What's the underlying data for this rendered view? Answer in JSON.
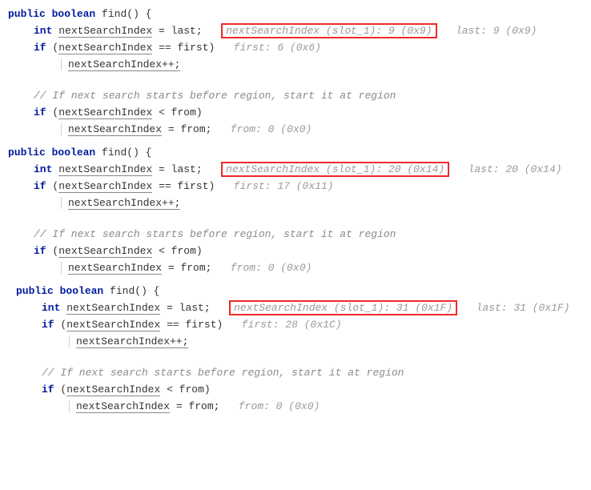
{
  "blocks": [
    {
      "sig_visibility": "public",
      "sig_type": "boolean",
      "sig_name": "find",
      "local_type": "int",
      "var_name": "nextSearchIndex",
      "assign_rhs": "last",
      "highlight_text": "nextSearchIndex (slot_1): 9 (0x9)",
      "last_annot": "last: 9 (0x9)",
      "cond1_rhs": "first",
      "first_annot": "first: 6 (0x6)",
      "incr_text": "nextSearchIndex++;",
      "comment_text": "// If next search starts before region, start it at region",
      "cond2_rhs": "from",
      "assign2_rhs": "from",
      "from_annot": "from: 0 (0x0)",
      "base_indent": 0
    },
    {
      "sig_visibility": "public",
      "sig_type": "boolean",
      "sig_name": "find",
      "local_type": "int",
      "var_name": "nextSearchIndex",
      "assign_rhs": "last",
      "highlight_text": "nextSearchIndex (slot_1): 20 (0x14)",
      "last_annot": "last: 20 (0x14)",
      "cond1_rhs": "first",
      "first_annot": "first: 17 (0x11)",
      "incr_text": "nextSearchIndex++;",
      "comment_text": "// If next search starts before region, start it at region",
      "cond2_rhs": "from",
      "assign2_rhs": "from",
      "from_annot": "from: 0 (0x0)",
      "base_indent": 0
    },
    {
      "sig_visibility": "public",
      "sig_type": "boolean",
      "sig_name": "find",
      "local_type": "int",
      "var_name": "nextSearchIndex",
      "assign_rhs": "last",
      "highlight_text": "nextSearchIndex (slot_1): 31 (0x1F)",
      "last_annot": "last: 31 (0x1F)",
      "cond1_rhs": "first",
      "first_annot": "first: 28 (0x1C)",
      "incr_text": "nextSearchIndex++;",
      "comment_text": "// If next search starts before region, start it at region",
      "cond2_rhs": "from",
      "assign2_rhs": "from",
      "from_annot": "from: 0 (0x0)",
      "base_indent": 1
    }
  ],
  "tokens": {
    "if": "if",
    "open_paren_brace": "() {",
    "eq": " = ",
    "semi": ";",
    "eqeq": " == ",
    "lt": " < ",
    "open_p": "(",
    "close_p": ")"
  }
}
